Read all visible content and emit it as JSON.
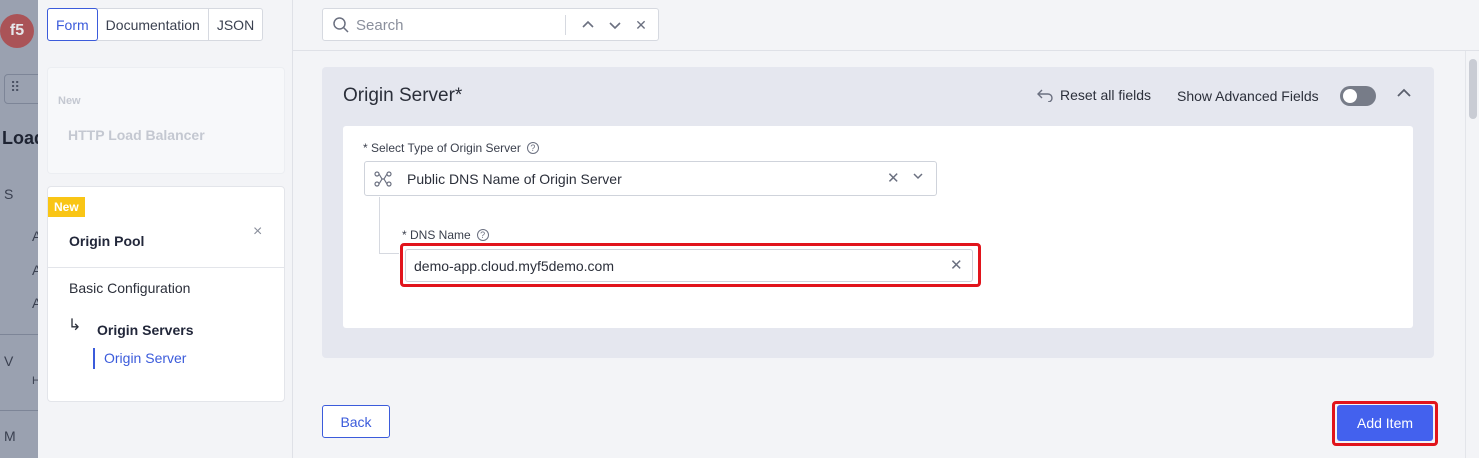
{
  "background_app": {
    "logo": "f5",
    "title": "Load",
    "letters": [
      "S",
      "A",
      "A",
      "A",
      "V",
      "H",
      "M"
    ]
  },
  "view_tabs": [
    {
      "label": "Form",
      "active": true
    },
    {
      "label": "Documentation",
      "active": false
    },
    {
      "label": "JSON",
      "active": false
    }
  ],
  "side_cards": {
    "new_card": {
      "tag": "New",
      "name": "HTTP Load Balancer"
    },
    "pool_card": {
      "badge": "New",
      "title": "Origin Pool",
      "nav": {
        "basic": "Basic Configuration",
        "origin_servers": "Origin Servers",
        "origin_server": "Origin Server"
      }
    }
  },
  "search": {
    "placeholder": "Search",
    "value": ""
  },
  "section": {
    "title": "Origin Server",
    "required_mark": "*",
    "reset_label": "Reset all fields",
    "advanced_label": "Show Advanced Fields",
    "advanced_enabled": false
  },
  "form": {
    "type_label": "* Select Type of Origin Server",
    "type_value": "Public DNS Name of Origin Server",
    "dns_label": "* DNS Name",
    "dns_value": "demo-app.cloud.myf5demo.com"
  },
  "buttons": {
    "back": "Back",
    "add": "Add Item"
  },
  "colors": {
    "accent": "#4361ee",
    "highlight": "#e1141c",
    "badge": "#f9c515"
  }
}
